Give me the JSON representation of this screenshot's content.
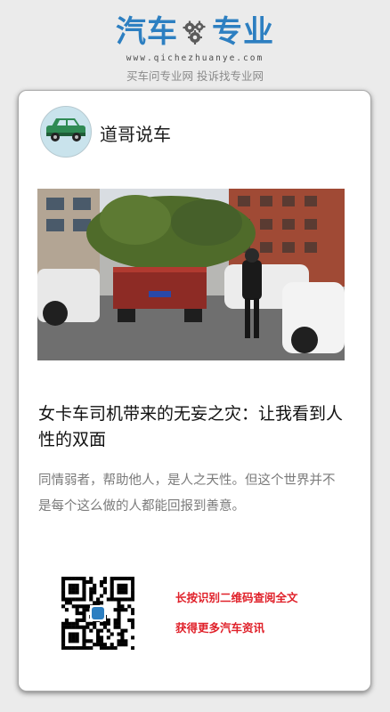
{
  "header": {
    "brand_part1": "汽车",
    "brand_part2": "专业",
    "website": "www.qichezhuanye.com",
    "slogan": "买车问专业网 投诉找专业网",
    "brand_color": "#2d7fc1",
    "gear_icon": "gear-icon"
  },
  "article": {
    "author_name": "道哥说车",
    "avatar_icon": "green-suv-icon",
    "photo_alt": "卡车",
    "title": "女卡车司机带来的无妄之灾：让我看到人性的双面",
    "summary": "同情弱者，帮助他人，是人之天性。但这个世界并不是每个这么做的人都能回报到善意。"
  },
  "footer": {
    "qr_icon": "qr-code-icon",
    "cta_line1": "长按识别二维码查阅全文",
    "cta_line2": "获得更多汽车资讯",
    "cta_color": "#e0212a"
  }
}
